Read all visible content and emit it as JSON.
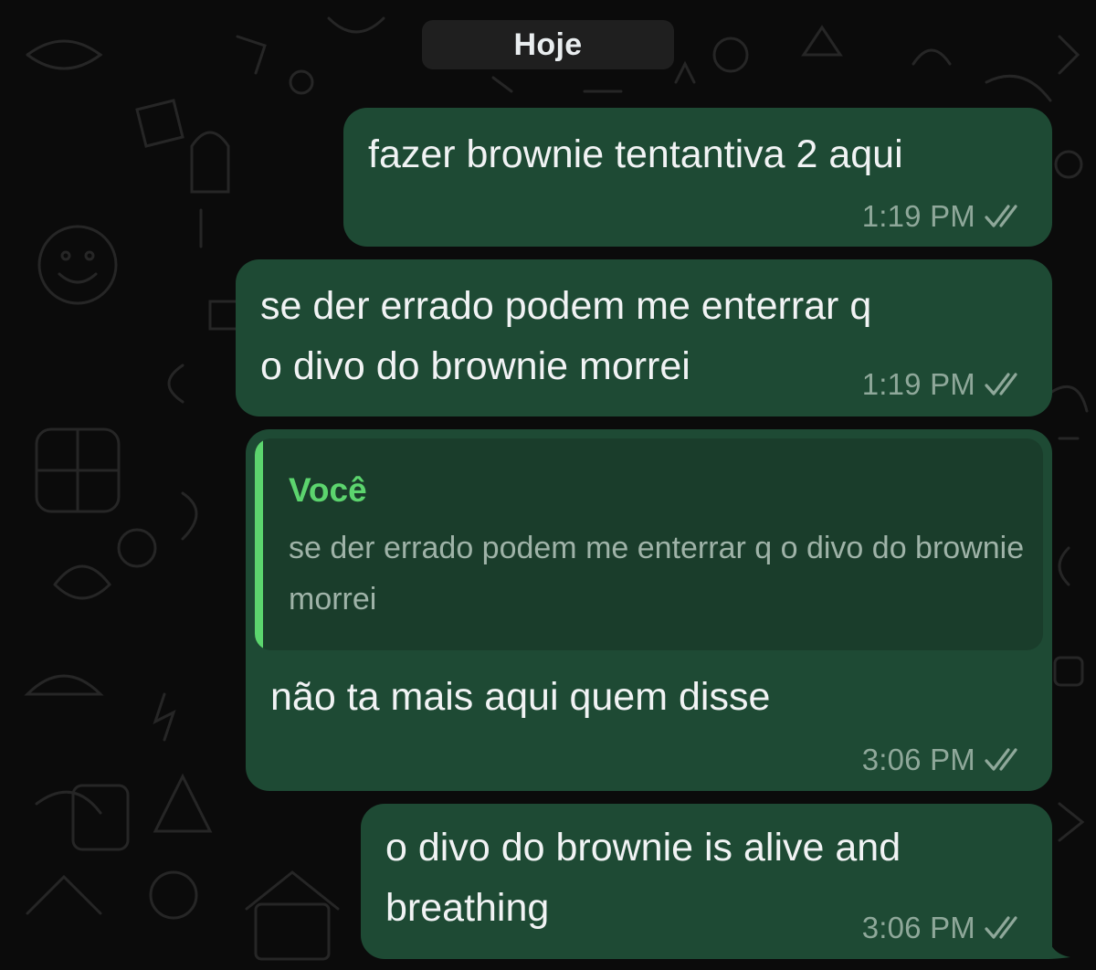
{
  "chat": {
    "date_separator": "Hoje",
    "messages": [
      {
        "text": "fazer brownie tentantiva 2 aqui",
        "time": "1:19 PM",
        "status_icon": "double-check-icon"
      },
      {
        "text": "se der errado podem me enterrar q\no divo do brownie morrei",
        "time": "1:19 PM",
        "status_icon": "double-check-icon"
      },
      {
        "quote": {
          "author": "Você",
          "text": "se der errado podem me enterrar q o divo do brownie morrei"
        },
        "text": "não ta mais aqui quem disse",
        "time": "3:06 PM",
        "status_icon": "double-check-icon"
      },
      {
        "text": "o divo do brownie is alive and\nbreathing",
        "time": "3:06 PM",
        "status_icon": "double-check-icon"
      }
    ]
  },
  "colors": {
    "background": "#0b0b0b",
    "outgoing_bubble": "#1e4a34",
    "quote_background": "#1a3d2b",
    "quote_accent": "#5cd56e",
    "timestamp": "#8fa89a",
    "date_chip": "#1f1f1f"
  }
}
